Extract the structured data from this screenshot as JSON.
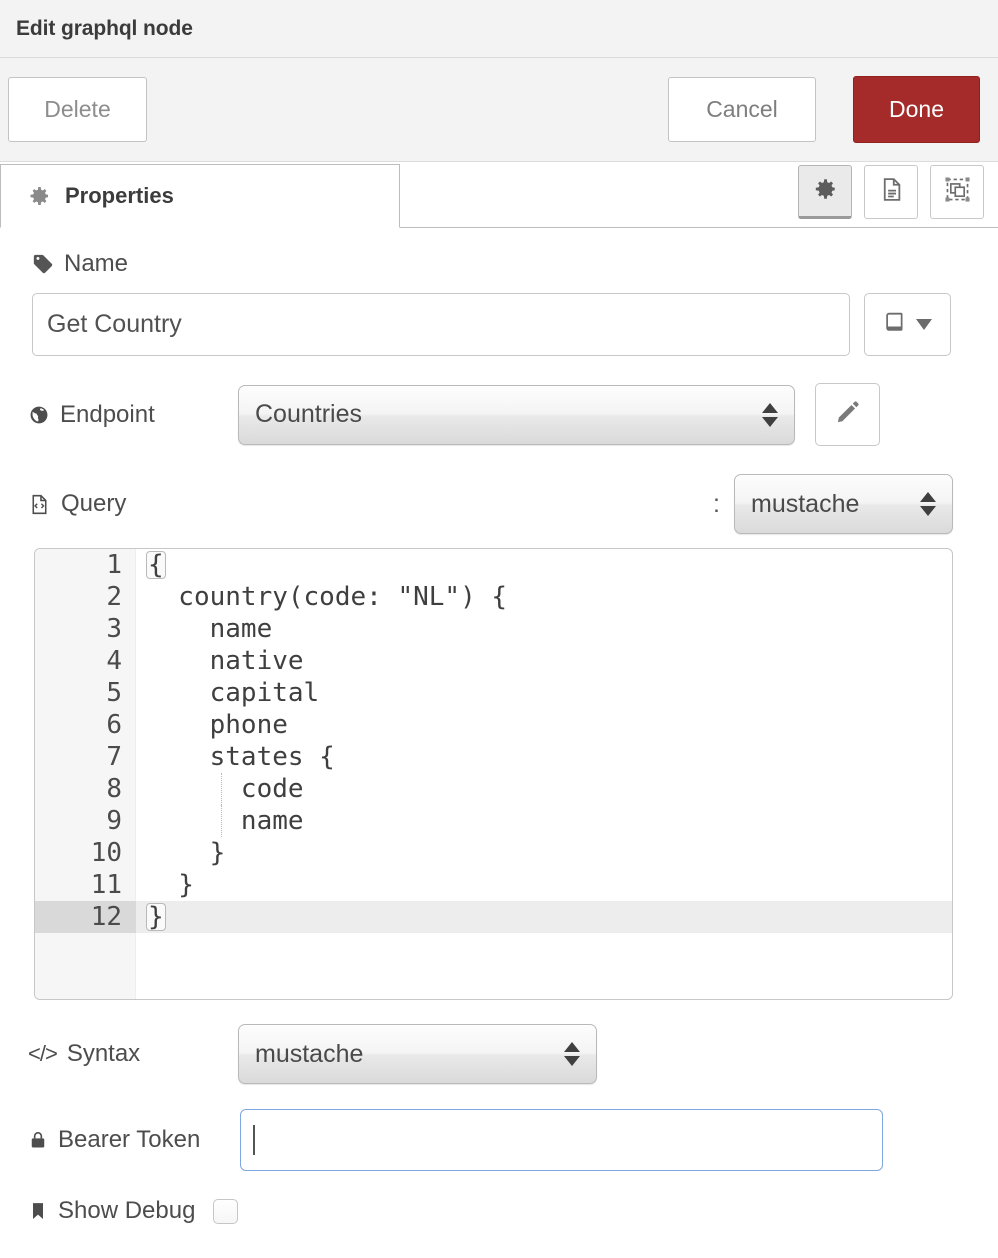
{
  "window": {
    "title": "Edit graphql node"
  },
  "toolbar": {
    "delete_label": "Delete",
    "cancel_label": "Cancel",
    "done_label": "Done",
    "done_color": "#a52a2a"
  },
  "tabs": [
    {
      "label": "Properties",
      "icon": "gear-icon",
      "active": true
    }
  ],
  "panel_buttons": [
    {
      "name": "properties-panel-button",
      "icon": "gear-icon",
      "active": true
    },
    {
      "name": "description-panel-button",
      "icon": "document-icon",
      "active": false
    },
    {
      "name": "appearance-panel-button",
      "icon": "object-frame-icon",
      "active": false
    }
  ],
  "fields": {
    "name": {
      "label": "Name",
      "icon": "tag-icon",
      "value": "Get Country",
      "placeholder": "Name",
      "menu_icon": "book-icon",
      "menu_caret": "chevron-down-icon"
    },
    "endpoint": {
      "label": "Endpoint",
      "icon": "globe-icon",
      "value": "Countries",
      "edit_icon": "pencil-icon"
    },
    "query": {
      "label": "Query",
      "icon": "file-code-icon",
      "separator": ":",
      "format": "mustache",
      "code_lines": [
        "{",
        "  country(code: \"NL\") {",
        "    name",
        "    native",
        "    capital",
        "    phone",
        "    states {",
        "      code",
        "      name",
        "    }",
        "  }",
        "}"
      ],
      "line_numbers": [
        "1",
        "2",
        "3",
        "4",
        "5",
        "6",
        "7",
        "8",
        "9",
        "10",
        "11",
        "12"
      ],
      "active_line": 12,
      "bracket_match_lines": [
        1,
        12
      ]
    },
    "syntax": {
      "label": "Syntax",
      "icon": "code-tag-icon",
      "icon_text": "</>",
      "value": "mustache"
    },
    "bearer_token": {
      "label": "Bearer Token",
      "icon": "lock-icon",
      "value": "",
      "focused": true
    },
    "show_debug": {
      "label": "Show Debug",
      "icon": "bookmark-icon",
      "checked": false
    }
  }
}
